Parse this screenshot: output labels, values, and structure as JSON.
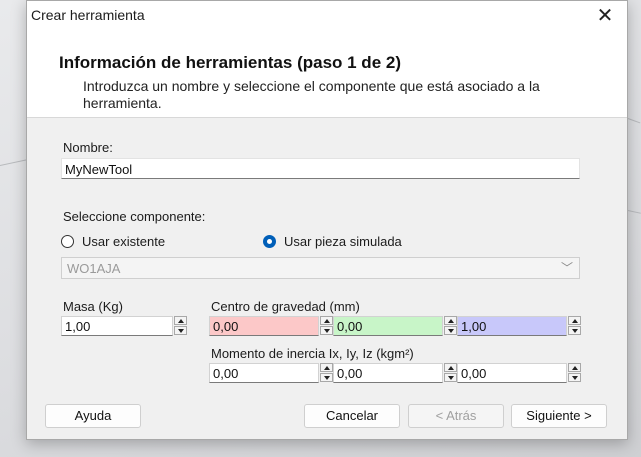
{
  "window": {
    "title": "Crear herramienta",
    "close_glyph": "✕"
  },
  "header": {
    "title": "Información de herramientas (paso 1 de 2)",
    "description": "Introduzca un nombre y seleccione el componente que está asociado a la herramienta."
  },
  "name": {
    "label": "Nombre:",
    "value": "MyNewTool"
  },
  "component": {
    "label": "Seleccione componente:",
    "option_existing": "Usar existente",
    "option_simulated": "Usar pieza simulada",
    "selected": "Usar pieza simulada",
    "dropdown_value": "WO1AJA"
  },
  "mass": {
    "label": "Masa (Kg)",
    "value": "1,00"
  },
  "center_of_gravity": {
    "label": "Centro de gravedad (mm)",
    "x": "0,00",
    "y": "0,00",
    "z": "1,00",
    "colors": {
      "x": "#fcc8c8",
      "y": "#c8f5c8",
      "z": "#c8c8fa"
    }
  },
  "moment_of_inertia": {
    "label": "Momento de inercia Ix, Iy, Iz (kgm²)",
    "ix": "0,00",
    "iy": "0,00",
    "iz": "0,00"
  },
  "buttons": {
    "help": "Ayuda",
    "cancel": "Cancelar",
    "back": "< Atrás",
    "next": "Siguiente >"
  }
}
